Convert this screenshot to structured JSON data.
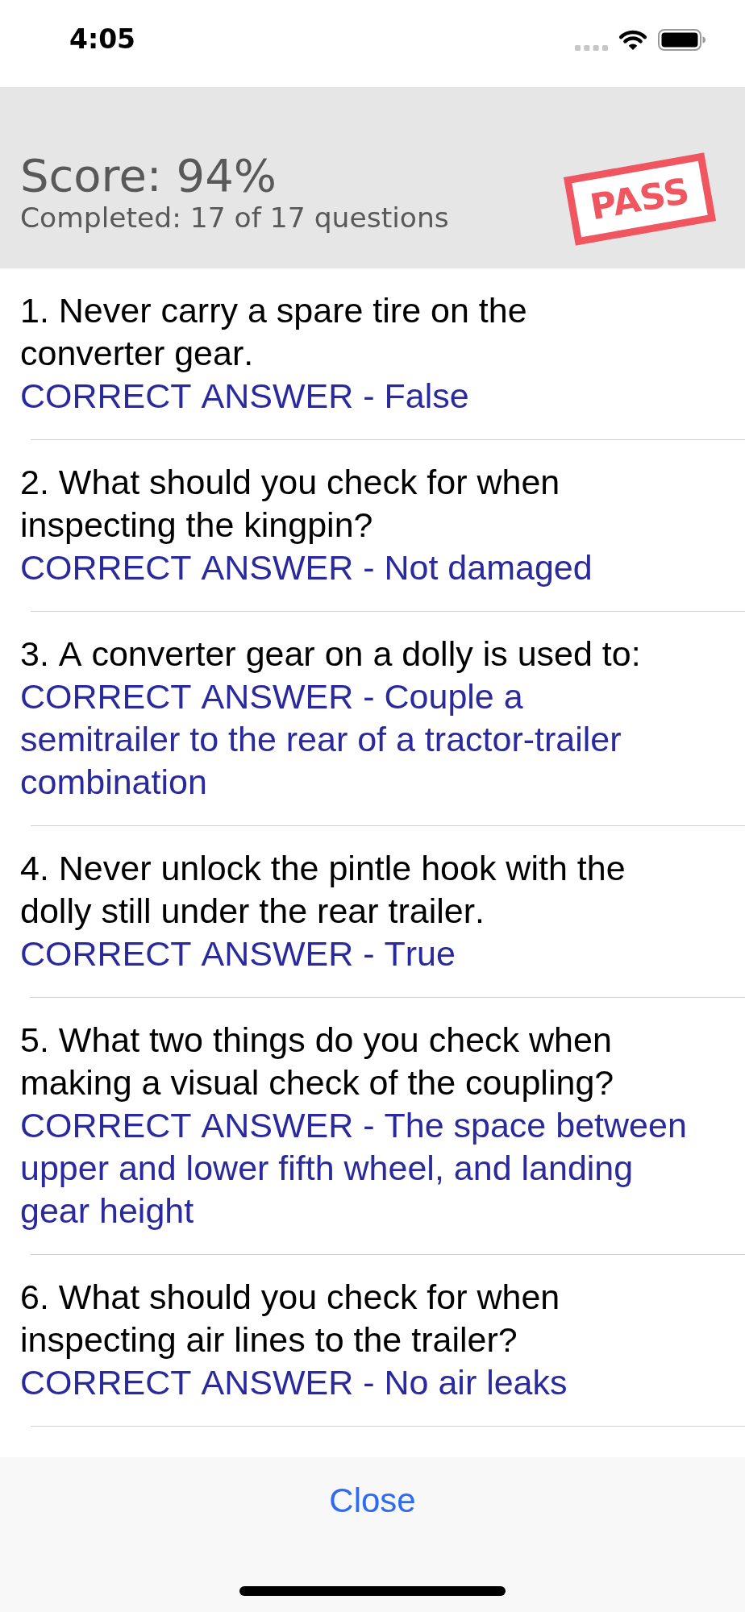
{
  "status_bar": {
    "time": "4:05"
  },
  "header": {
    "score": "Score: 94%",
    "completed": "Completed: 17 of 17 questions",
    "stamp": "PASS"
  },
  "questions": [
    {
      "question": "1. Never carry a spare tire on the converter gear.",
      "answer": "CORRECT ANSWER - False"
    },
    {
      "question": "2. What should you check for when inspecting the kingpin?",
      "answer": "CORRECT ANSWER - Not damaged"
    },
    {
      "question": "3. A converter gear on a dolly is used to:",
      "answer": "CORRECT ANSWER - Couple a semitrailer to the rear of a tractor-trailer combination"
    },
    {
      "question": "4. Never unlock the pintle hook with the dolly still under the rear trailer.",
      "answer": "CORRECT ANSWER - True"
    },
    {
      "question": "5. What two things do you check when making a visual check of the coupling?",
      "answer": "CORRECT ANSWER - The space between upper and lower fifth wheel, and landing gear height"
    },
    {
      "question": "6. What should you check for when inspecting air lines to the trailer?",
      "answer": "CORRECT ANSWER - No air leaks"
    }
  ],
  "footer": {
    "button": "Close"
  }
}
